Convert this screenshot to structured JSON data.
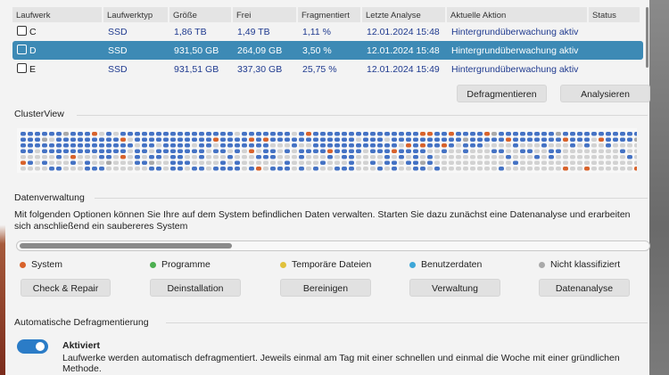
{
  "colors": {
    "accent": "#3d8ab5",
    "system": "#d8622b",
    "programs": "#4caf50",
    "temp": "#e0c13c",
    "user": "#3ea7d8",
    "unclassified": "#a9a9a9",
    "data": "#4472c4",
    "empty": "#d2d2d2"
  },
  "table": {
    "headers": [
      "Laufwerk",
      "Laufwerktyp",
      "Größe",
      "Frei",
      "Fragmentiert",
      "Letzte Analyse",
      "Aktuelle Aktion",
      "Status"
    ],
    "rows": [
      {
        "drive": "C",
        "type": "SSD",
        "size": "1,86 TB",
        "free": "1,49 TB",
        "frag": "1,11 %",
        "last": "12.01.2024 15:48",
        "action": "Hintergrundüberwachung aktiv",
        "status": "",
        "selected": false
      },
      {
        "drive": "D",
        "type": "SSD",
        "size": "931,50 GB",
        "free": "264,09 GB",
        "frag": "3,50 %",
        "last": "12.01.2024 15:48",
        "action": "Hintergrundüberwachung aktiv",
        "status": "",
        "selected": true
      },
      {
        "drive": "E",
        "type": "SSD",
        "size": "931,51 GB",
        "free": "337,30 GB",
        "frag": "25,75 %",
        "last": "12.01.2024 15:49",
        "action": "Hintergrundüberwachung aktiv",
        "status": "",
        "selected": false
      }
    ]
  },
  "buttons": {
    "defrag": "Defragmentieren",
    "analyze": "Analysieren"
  },
  "clusterview": {
    "title": "ClusterView"
  },
  "datenverwaltung": {
    "title": "Datenverwaltung",
    "description": "Mit folgenden Optionen können Sie Ihre auf dem System befindlichen Daten verwalten. Starten Sie dazu zunächst eine Datenanalyse und erarbeiten sich anschließend ein saubereres System",
    "legend": [
      {
        "label": "System",
        "color": "#d8622b"
      },
      {
        "label": "Programme",
        "color": "#4caf50"
      },
      {
        "label": "Temporäre Dateien",
        "color": "#e0c13c"
      },
      {
        "label": "Benutzerdaten",
        "color": "#3ea7d8"
      },
      {
        "label": "Nicht klassifiziert",
        "color": "#a9a9a9"
      }
    ],
    "buttons": [
      "Check & Repair",
      "Deinstallation",
      "Bereinigen",
      "Verwaltung",
      "Datenanalyse"
    ]
  },
  "auto_defrag": {
    "title": "Automatische Defragmentierung",
    "enabled": true,
    "label": "Aktiviert",
    "description": "Laufwerke werden automatisch defragmentiert. Jeweils einmal am Tag mit einer schnellen und einmal die Woche mit einer gründlichen Methode."
  }
}
